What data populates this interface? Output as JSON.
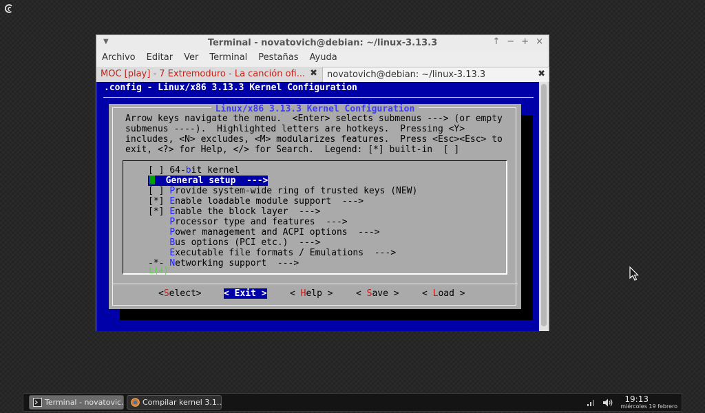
{
  "window": {
    "title": "Terminal - novatovich@debian: ~/linux-3.13.3",
    "menu": [
      "Archivo",
      "Editar",
      "Ver",
      "Terminal",
      "Pestañas",
      "Ayuda"
    ],
    "tabs": [
      {
        "label": "MOC [play] - 7 Extremoduro - La canción ofi...",
        "color": "#c0201a"
      },
      {
        "label": "novatovich@debian: ~/linux-3.13.3"
      }
    ],
    "controls": [
      "↑",
      "−",
      "+",
      "×"
    ]
  },
  "kconfig": {
    "top_title": ".config - Linux/x86 3.13.3 Kernel Configuration",
    "dialog_title": "Linux/x86 3.13.3 Kernel Configuration",
    "help_text": "Arrow keys navigate the menu.  <Enter> selects submenus ---> (or empty\nsubmenus ----).  Highlighted letters are hotkeys.  Pressing <Y>\nincludes, <N> excludes, <M> modularizes features.  Press <Esc><Esc> to\nexit, <?> for Help, </> for Search.  Legend: [*] built-in  [ ]",
    "items": [
      {
        "prefix": "[ ] ",
        "pre": "64-",
        "hk": "b",
        "rest": "it kernel"
      },
      {
        "prefix": "    ",
        "pre": "",
        "hk": "",
        "rest": "General setup  --->",
        "selected": true
      },
      {
        "prefix": "[ ] ",
        "pre": "",
        "hk": "P",
        "rest": "rovide system-wide ring of trusted keys (NEW)"
      },
      {
        "prefix": "[*] ",
        "pre": "",
        "hk": "E",
        "rest": "nable loadable module support  --->"
      },
      {
        "prefix": "[*] ",
        "pre": "",
        "hk": "E",
        "rest": "nable the block layer  --->"
      },
      {
        "prefix": "    ",
        "pre": "",
        "hk": "P",
        "rest": "rocessor type and features  --->"
      },
      {
        "prefix": "    ",
        "pre": "",
        "hk": "P",
        "rest": "ower management and ACPI options  --->"
      },
      {
        "prefix": "    ",
        "pre": "",
        "hk": "B",
        "rest": "us options (PCI etc.)  --->"
      },
      {
        "prefix": "    ",
        "pre": "",
        "hk": "E",
        "rest": "xecutable file formats / Emulations  --->"
      },
      {
        "prefix": "-*- ",
        "pre": "",
        "hk": "N",
        "rest": "etworking support  --->"
      }
    ],
    "more_indicator": "L(+)",
    "buttons": [
      {
        "pre": "<",
        "hk": "S",
        "rest": "elect>"
      },
      {
        "pre": "< Exit >",
        "hk": "",
        "rest": "",
        "active": true
      },
      {
        "pre": "< ",
        "hk": "H",
        "rest": "elp >"
      },
      {
        "pre": "< ",
        "hk": "S",
        "rest": "ave >"
      },
      {
        "pre": "< ",
        "hk": "L",
        "rest": "oad >"
      }
    ],
    "colors": {
      "background": "#0000a8",
      "dialog": "#aaaaaa",
      "hotkey": "#2323ff",
      "button_hotkey": "#c01818",
      "cursor": "#00a000"
    }
  },
  "taskbar": {
    "tasks": [
      {
        "label": "Terminal - novatovic...",
        "icon": "terminal-icon"
      },
      {
        "label": "Compilar kernel 3.1...",
        "icon": "browser-icon"
      }
    ],
    "tray_icons": [
      "network-signal-icon",
      "volume-icon"
    ],
    "clock": {
      "time": "19:13",
      "date": "miércoles 19 febrero"
    }
  }
}
